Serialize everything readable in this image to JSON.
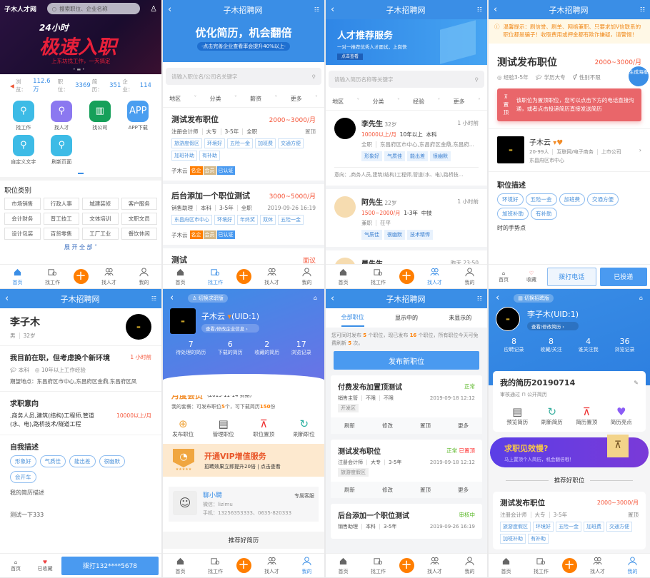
{
  "colors": {
    "brand": "#3a8ee6",
    "orange": "#ff7e00",
    "salary": "#f5563a",
    "green": "#5cb82a"
  },
  "nav": [
    "首页",
    "找工作",
    "找人才",
    "我的"
  ],
  "p1": {
    "logo": "子木人才网",
    "search_placeholder": "搜索职位、企业名称",
    "banner_small": "24小时",
    "banner_big": "极速入职",
    "banner_sub": "上东坊找工作，一天搞定",
    "stats": [
      {
        "label": "浏览：",
        "value": "112.6万"
      },
      {
        "label": "职位：",
        "value": "3369"
      },
      {
        "label": "简历：",
        "value": "351"
      },
      {
        "label": "企业：",
        "value": "114"
      }
    ],
    "shortcuts": [
      {
        "label": "找工作",
        "color": "#3dbbe6"
      },
      {
        "label": "找人才",
        "color": "#8b78f0"
      },
      {
        "label": "找公司",
        "color": "#16a05a"
      },
      {
        "label": "APP下载",
        "color": "#4a9ef0"
      },
      {
        "label": "自定义文字",
        "color": "#3dbbe6"
      },
      {
        "label": "刷新页面",
        "color": "#3dbbe6"
      }
    ],
    "category_title": "职位类别",
    "categories": [
      "市场销售",
      "行政人事",
      "城建装修",
      "客户服务",
      "会计财务",
      "普工技工",
      "文体培训",
      "文职文员",
      "设计包装",
      "百货零售",
      "工厂工业",
      "餐饮休闲"
    ],
    "expand": "展 开 全 部"
  },
  "p2": {
    "title": "子木招聘网",
    "banner_title": "优化简历，机会翻倍",
    "banner_sub": "·点击完善企业查看率会提升40%以上·",
    "search_placeholder": "请输入职位名/公司名关键字",
    "filters": [
      "地区",
      "分类",
      "薪资",
      "更多"
    ],
    "jobs": [
      {
        "title": "测试发布职位",
        "salary": "2000~3000/月",
        "meta": [
          "注册会计师",
          "大专",
          "3-5年",
          "全职"
        ],
        "right": "置顶",
        "tags": [
          "旅游度假区",
          "环境好",
          "五险一金",
          "加班费",
          "交通方便",
          "加班补助",
          "有补助"
        ],
        "company": "子木云",
        "badges": [
          "名企",
          "会员",
          "已认证"
        ]
      },
      {
        "title": "后台添加一个职位测试",
        "salary": "3000~5000/月",
        "meta": [
          "销售助理",
          "本科",
          "3-5年",
          "全职"
        ],
        "right": "2019-09-26 16:19",
        "tags": [
          "东昌府区市中心",
          "环境好",
          "年终奖",
          "双休",
          "五险一金"
        ],
        "company": "子木云",
        "badges": [
          "名企",
          "会员",
          "已认证"
        ]
      },
      {
        "title": "测试",
        "salary": "面议"
      }
    ]
  },
  "p3": {
    "title": "子木招聘网",
    "banner_title": "人才推荐服务",
    "banner_sub": "一对一推荐优秀人才面试，上岗快",
    "banner_btn": "点击查看",
    "search_placeholder": "请输入简历名称等关键字",
    "filters": [
      "地区",
      "分类",
      "经验",
      "更多"
    ],
    "people": [
      {
        "name": "李先生",
        "age": "32岁",
        "time": "1 小时前",
        "salary": "10000以上/月",
        "exp": "10年以上",
        "edu": "本科",
        "type": "全职",
        "loc": "东昌府区市中心,东昌府区金鼎,东昌府...",
        "tags": [
          "形象好",
          "气质佳",
          "能出差",
          "很幽默"
        ],
        "intent": "意向：,商务人员,建筑(结构)工程师,管道(水、电),路桥技..."
      },
      {
        "name": "阿先生",
        "age": "22岁",
        "time": "1 小时前",
        "salary": "1500~2000/月",
        "exp": "1-3年",
        "edu": "中技",
        "type": "兼职",
        "loc": "茌平",
        "tags": [
          "气质佳",
          "很幽默",
          "技术精悍"
        ]
      },
      {
        "name": "晨先生",
        "time": "昨天 23:50"
      }
    ]
  },
  "p4": {
    "title": "子木招聘网",
    "warning": "温馨提示：刷信誉、刷单、网络兼职、只要求加V信联系的职位都是骗子！收取费用或押金都有欺诈嫌疑，请警惕！",
    "poster_btn": "生成海报",
    "job_title": "测试发布职位",
    "salary": "2000~3000/月",
    "reqs": [
      "经验3-5年",
      "学历大专",
      "性别不限"
    ],
    "top_label": "置顶",
    "top_notice": "该职位为置顶职位，您可以点击下方的电话直接沟通，或者点击投递简历直接发送简历",
    "company": {
      "name": "子木云",
      "meta": [
        "20-99人",
        "互联网/电子商务",
        "上市公司"
      ],
      "address": "东昌府区市中心"
    },
    "desc_title": "职位描述",
    "tags": [
      "环境好",
      "五险一金",
      "加班费",
      "交通方便",
      "加班补助",
      "有补助"
    ],
    "desc": "时的手势点",
    "bottom": {
      "home": "首页",
      "fav": "收藏",
      "call": "拨打电话",
      "applied": "已投递"
    }
  },
  "p5": {
    "title": "子木招聘网",
    "name": "李子木",
    "gender": "男",
    "age": "32岁",
    "status": "我目前在职，但考虑换个新环境",
    "time": "1 小时前",
    "edu": "本科",
    "exp": "10年以上工作经验",
    "location": "期望地点：东昌府区市中心,东昌府区金鼎,东昌府区凤",
    "intent_title": "求职意向",
    "intent": ",商务人员,建筑(结构)工程师,管道(水、电),路桥技术/隧道工程",
    "salary": "10000以上/月",
    "self_title": "自我描述",
    "tags": [
      "形象好",
      "气质佳",
      "能出差",
      "很幽默",
      "会开车"
    ],
    "desc1": "我的简历描述",
    "desc2": "测试一下333",
    "bottom": {
      "home": "首页",
      "fav": "已收藏",
      "call": "拨打132****5678"
    }
  },
  "p6": {
    "switch": "切换求职版",
    "company": "子木云",
    "uid": "(UID:1)",
    "edit": "查看/修改企业信息 ›",
    "stats": [
      {
        "value": "7",
        "label": "待处理的简历"
      },
      {
        "value": "6",
        "label": "下载的简历"
      },
      {
        "value": "2",
        "label": "收藏的简历"
      },
      {
        "value": "17",
        "label": "浏览记录"
      }
    ],
    "member": "月度会员",
    "expire": "(2019-11-14 到期)",
    "plan": {
      "a": "我的套餐：可发布职位",
      "jobs": "5",
      "b": "个，可下载简历",
      "resumes": "150",
      "c": "份"
    },
    "actions": [
      "发布职位",
      "管理职位",
      "职位置顶",
      "刷新职位"
    ],
    "vip_title": "开通VIP增值服务",
    "vip_sub": "招聘效果立即提升20倍  |  点击查看",
    "vip_stars": "★★★★★",
    "service": {
      "name": "聊小聘",
      "label": "专属客服",
      "wechat": "微信：lizimu",
      "phone": "手机：13256353333、0635-820333"
    },
    "recommend": "推荐好简历"
  },
  "p7": {
    "title": "子木招聘网",
    "tabs": [
      "全部职位",
      "显示中的",
      "未显示的"
    ],
    "notice": {
      "a": "您可同时发布 ",
      "n1": "5",
      "b": " 个职位，现已发布 ",
      "n2": "16",
      "c": " 个职位，所有职位今天可免费刷新 ",
      "n3": "5",
      "d": " 次。"
    },
    "publish": "发布新职位",
    "jobs": [
      {
        "title": "付费发布加置顶测试",
        "status": "正常",
        "top": "",
        "meta": [
          "销售主管",
          "不限",
          "不限"
        ],
        "date": "2019-09-18 12:12",
        "area": "开发区"
      },
      {
        "title": "测试发布职位",
        "status": "正常",
        "top": "已置顶",
        "meta": [
          "注册会计师",
          "大专",
          "3-5年"
        ],
        "date": "2019-09-18 12:12",
        "area": "旅游度假区"
      },
      {
        "title": "后台添加一个职位测试",
        "status": "审核中",
        "meta": [
          "销售助理",
          "本科",
          "3-5年"
        ],
        "date": "2019-09-26 16:19"
      }
    ],
    "actions": [
      "刷新",
      "修改",
      "置顶",
      "更多"
    ]
  },
  "p8": {
    "switch": "切换招聘版",
    "name": "李子木(UID:1)",
    "edit": "查看/修改简历 ›",
    "stats": [
      {
        "value": "8",
        "label": "应聘记录"
      },
      {
        "value": "8",
        "label": "收藏/关注"
      },
      {
        "value": "4",
        "label": "谁关注我"
      },
      {
        "value": "36",
        "label": "浏览记录"
      }
    ],
    "resume_title": "我的简历20190714",
    "resume_status": "审核通过",
    "privacy": "公开简历",
    "actions": [
      "预览简历",
      "刷新简历",
      "简历置顶",
      "简历亮点"
    ],
    "banner_title": "求职见效慢?",
    "banner_sub": "马上置顶个人简历，机会翻倍哦！",
    "recommend": "推荐好职位",
    "job": {
      "title": "测试发布职位",
      "salary": "2000~3000/月",
      "meta": [
        "注册会计师",
        "大专",
        "3-5年"
      ],
      "right": "置顶",
      "tags": [
        "旅游度假区",
        "环境好",
        "五险一金",
        "加班费",
        "交通方便",
        "加班补助",
        "有补助"
      ]
    }
  }
}
